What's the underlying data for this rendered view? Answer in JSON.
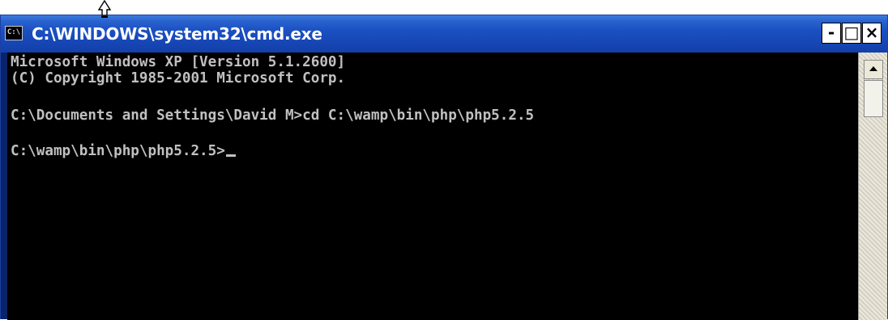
{
  "window": {
    "title": "C:\\WINDOWS\\system32\\cmd.exe",
    "icon_text": "C:\\",
    "icon": "cmd-console-icon",
    "controls": {
      "minimize": "-",
      "maximize": "□",
      "close": "×"
    }
  },
  "console": {
    "lines": [
      "Microsoft Windows XP [Version 5.1.2600]",
      "(C) Copyright 1985-2001 Microsoft Corp.",
      "C:\\Documents and Settings\\David M>cd C:\\wamp\\bin\\php\\php5.2.5",
      "C:\\wamp\\bin\\php\\php5.2.5>"
    ],
    "text_color": "#c0c0c0",
    "background": "#000000"
  },
  "scrollbar": {
    "up_icon": "scroll-up-arrow-icon"
  },
  "colors": {
    "titlebar": "#1b50c2",
    "title_text": "#ffffff"
  }
}
